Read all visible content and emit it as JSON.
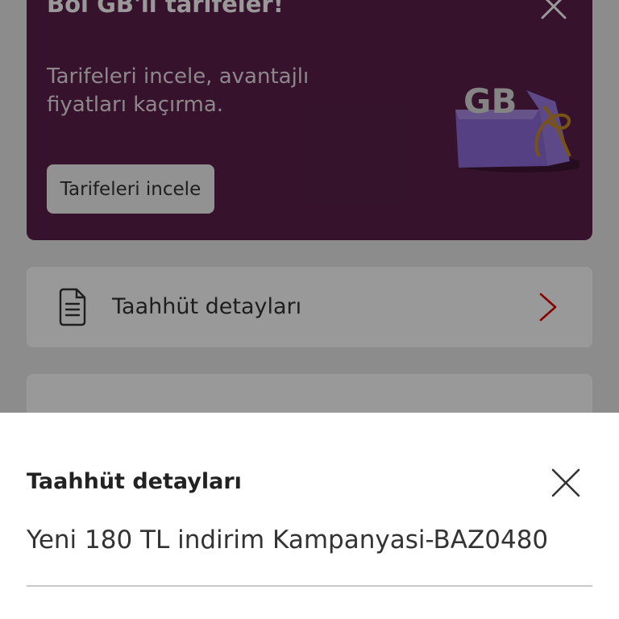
{
  "promo": {
    "title": "Bol GB'li tarifeler!",
    "subtitle": "Tarifeleri incele, avantajlı fiyatları kaçırma.",
    "button_label": "Tarifeleri incele",
    "gift_text": "GB",
    "background_color": "#5a1f4a"
  },
  "cards": {
    "taahhut_label": "Taahhüt detayları"
  },
  "sheet": {
    "title": "Taahhüt detayları",
    "campaign": "Yeni 180 TL indirim Kampanyasi-BAZ0480"
  },
  "colors": {
    "accent_red": "#e60000",
    "overlay": "rgba(0,0,0,0.40)"
  },
  "icons": {
    "promo_close": "close-icon",
    "card_doc": "document-icon",
    "card_chevron": "chevron-right-icon",
    "sheet_close": "close-icon"
  }
}
